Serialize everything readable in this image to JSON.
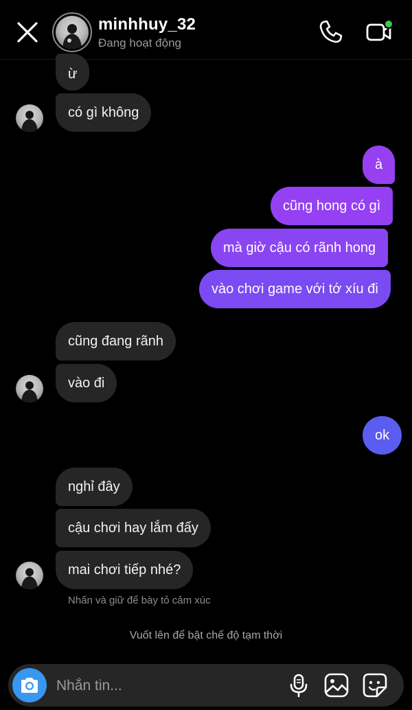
{
  "header": {
    "username": "minhhuy_32",
    "status": "Đang hoạt động",
    "icons": [
      "close-icon",
      "phone-icon",
      "video-icon"
    ],
    "online_dot_color": "#3ec74a"
  },
  "messages": [
    {
      "side": "in",
      "text": "ừ"
    },
    {
      "side": "in",
      "text": "có gì không"
    },
    {
      "side": "out",
      "text": "à"
    },
    {
      "side": "out",
      "text": "cũng hong có gì"
    },
    {
      "side": "out",
      "text": "mà giờ cậu có rãnh hong"
    },
    {
      "side": "out",
      "text": "vào chơi game với tớ xíu đi"
    },
    {
      "side": "in",
      "text": "cũng đang rãnh"
    },
    {
      "side": "in",
      "text": "vào đi"
    },
    {
      "side": "out",
      "text": "ok"
    },
    {
      "side": "in",
      "text": "nghỉ đây"
    },
    {
      "side": "in",
      "text": "cậu chơi hay lắm đấy"
    },
    {
      "side": "in",
      "text": "mai chơi tiếp nhé?"
    }
  ],
  "reaction_hint": "Nhấn và giữ để bày tỏ cảm xúc",
  "vanish_mode_hint": "Vuốt lên để bật chế độ tạm thời",
  "composer": {
    "placeholder": "Nhắn tin...",
    "icons": [
      "camera-icon",
      "microphone-icon",
      "gallery-icon",
      "sticker-icon"
    ]
  },
  "colors": {
    "incoming_bubble": "#262626",
    "outgoing_bubble_top": "#9b3df2",
    "outgoing_bubble_bottom": "#5a5cf0",
    "camera_button": "#3897f0"
  }
}
